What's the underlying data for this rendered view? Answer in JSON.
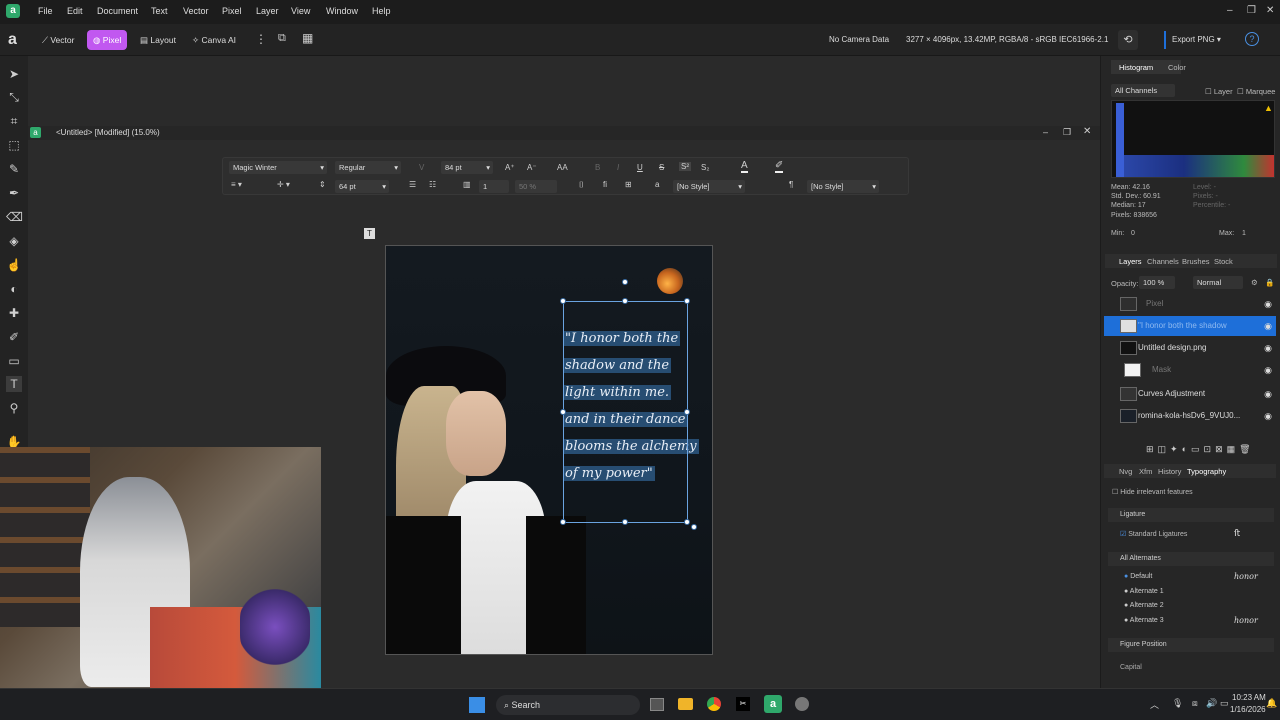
{
  "menu": [
    "File",
    "Edit",
    "Document",
    "Text",
    "Vector",
    "Pixel",
    "Layer",
    "View",
    "Window",
    "Help"
  ],
  "personas": {
    "vector": "Vector",
    "pixel": "Pixel",
    "layout": "Layout",
    "canva": "Canva AI"
  },
  "toolbar": {
    "camera": "No Camera Data",
    "info": "3277 × 4096px, 13.42MP, RGBA/8 - sRGB IEC61966-2.1",
    "export": "Export PNG"
  },
  "doc": {
    "title": "<Untitled> [Modified] (15.0%)"
  },
  "text_toolbar": {
    "font": "Magic Winter",
    "style": "Regular",
    "size": "84 pt",
    "leading": "64 pt",
    "columns": "1",
    "percent": "50 %",
    "para_style": "[No Style]",
    "char_style": "[No Style]"
  },
  "quote_lines": [
    "\"I honor both the",
    "shadow and the",
    "light within me.",
    "and in their dance",
    "blooms the alchemy",
    "of my power\""
  ],
  "histogram": {
    "tab1": "Histogram",
    "tab2": "Color",
    "channels": "All Channels",
    "layer": "Layer",
    "marquee": "Marquee",
    "mean": "Mean: 42.16",
    "stddev": "Std. Dev.: 60.91",
    "median": "Median: 17",
    "pixels": "Pixels: 838656",
    "level": "Level: -",
    "pixels2": "Pixels: -",
    "percentile": "Percentile: -",
    "min_label": "Min:",
    "min": "0",
    "max_label": "Max:",
    "max": "1"
  },
  "layers_tabs": [
    "Layers",
    "Channels",
    "Brushes",
    "Stock"
  ],
  "layers_opts": {
    "opacity_label": "Opacity:",
    "opacity": "100 %",
    "blend": "Normal"
  },
  "layers": [
    {
      "name": "Pixel",
      "dim": true
    },
    {
      "name": "\"I honor both the shadow",
      "selected": true
    },
    {
      "name": "Untitled design.png"
    },
    {
      "name": "Mask",
      "dim": true
    },
    {
      "name": "Curves Adjustment"
    },
    {
      "name": "romina-kola-hsDv6_9VUJ0..."
    }
  ],
  "bottom_tabs": [
    "Nvg",
    "Xfm",
    "History",
    "Typography"
  ],
  "typography": {
    "hide": "Hide irrelevant features",
    "ligature": "Ligature",
    "standard": "Standard Ligatures",
    "all_alt": "All Alternates",
    "alts": [
      "Default",
      "Alternate 1",
      "Alternate 2",
      "Alternate 3"
    ],
    "alt_preview": "honor",
    "figure": "Figure Position",
    "capital": "Capital"
  },
  "taskbar": {
    "search": "Search",
    "time": "10:23 AM",
    "date": "1/16/2026"
  },
  "colors": {
    "accent": "#c158f0",
    "selected": "#1e6fd9"
  }
}
